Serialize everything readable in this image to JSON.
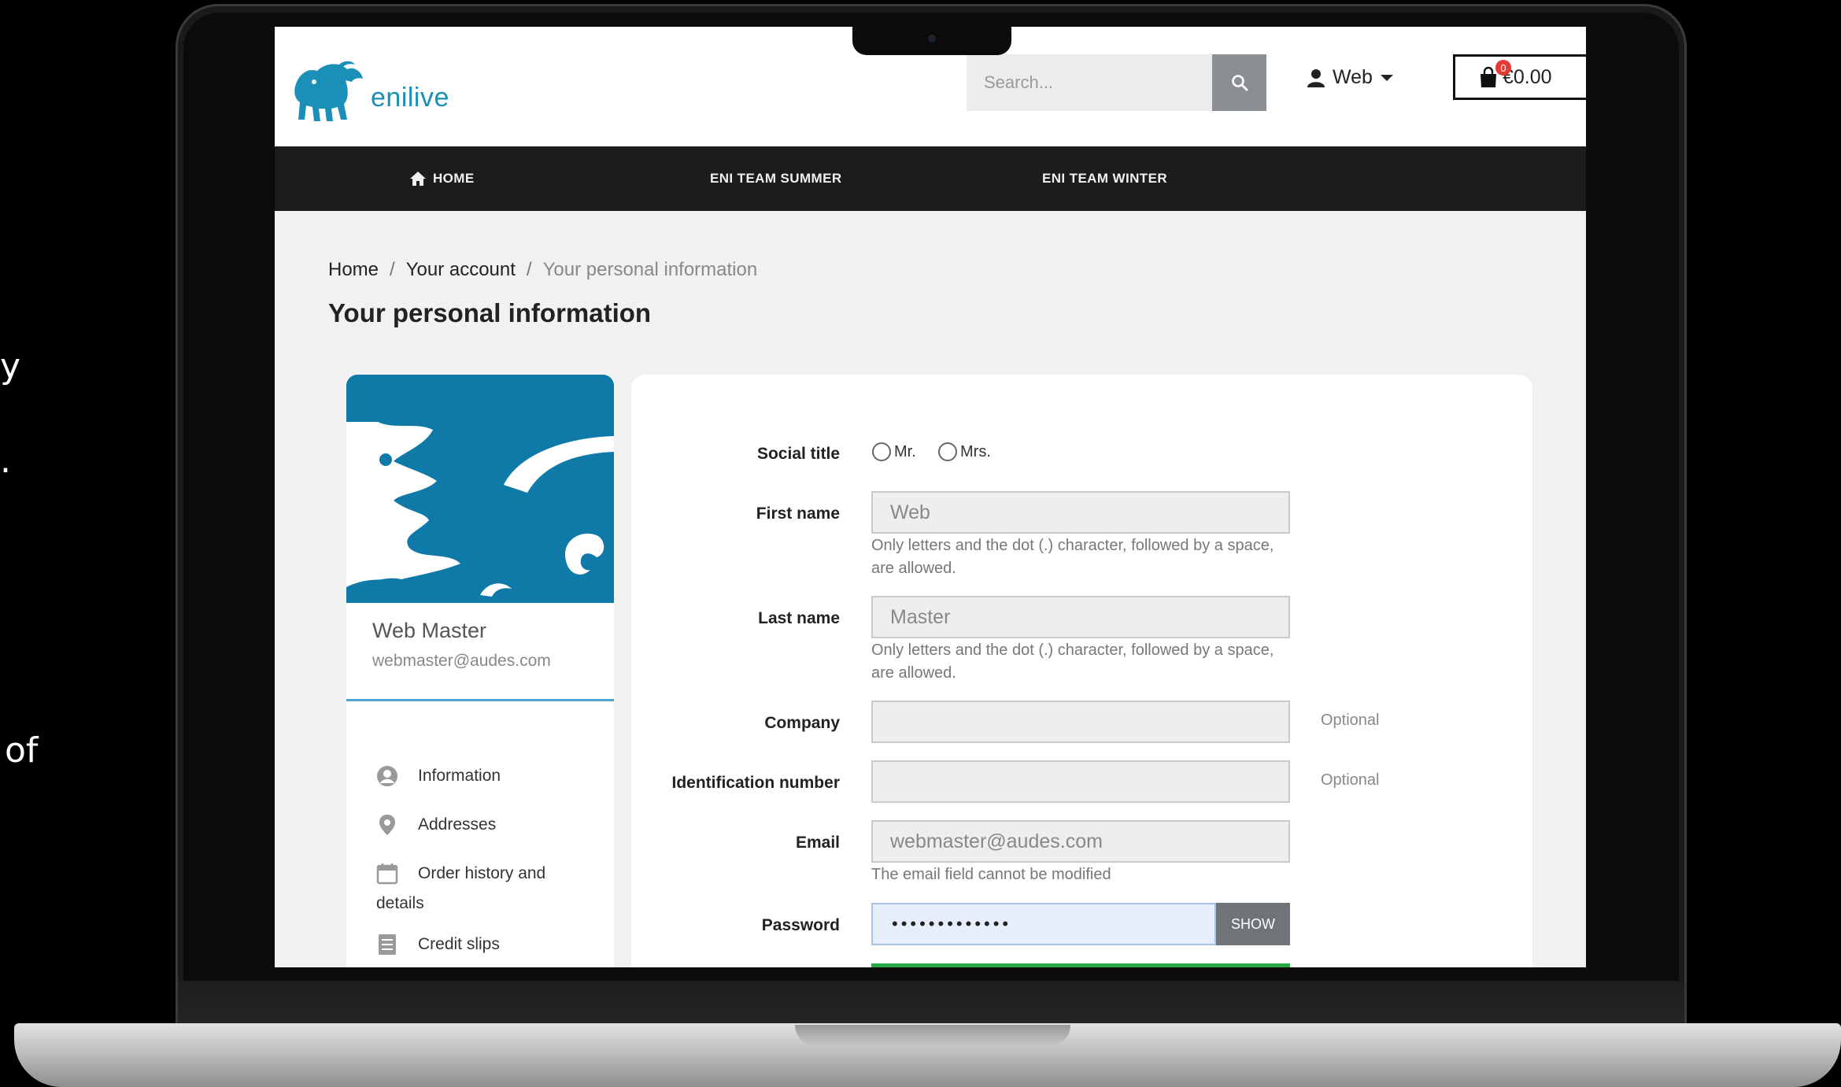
{
  "left_fragments": [
    {
      "text": "y"
    },
    {
      "text": "."
    },
    {
      "text": "of"
    }
  ],
  "header": {
    "logo_text": "enilive",
    "search_placeholder": "Search...",
    "user_label": "Web",
    "cart_count": "0",
    "cart_total": "€0.00"
  },
  "nav": {
    "items": [
      {
        "label": "HOME"
      },
      {
        "label": "ENI TEAM SUMMER"
      },
      {
        "label": "ENI TEAM WINTER"
      }
    ]
  },
  "breadcrumb": {
    "home": "Home",
    "account": "Your account",
    "current": "Your personal information",
    "separator": "/"
  },
  "page": {
    "title": "Your personal information"
  },
  "sidebar": {
    "name": "Web Master",
    "email": "webmaster@audes.com",
    "items": [
      {
        "label": "Information",
        "icon": "user-circle-icon"
      },
      {
        "label": "Addresses",
        "icon": "map-pin-icon"
      },
      {
        "label": "Order history and",
        "label2": "details",
        "icon": "calendar-icon"
      },
      {
        "label": "Credit slips",
        "icon": "document-icon"
      }
    ]
  },
  "form": {
    "social_title": {
      "label": "Social title",
      "options": [
        "Mr.",
        "Mrs."
      ]
    },
    "first_name": {
      "label": "First name",
      "value": "Web",
      "hint": "Only letters and the dot (.) character, followed by a space, are allowed."
    },
    "last_name": {
      "label": "Last name",
      "value": "Master",
      "hint": "Only letters and the dot (.) character, followed by a space, are allowed."
    },
    "company": {
      "label": "Company",
      "value": "",
      "optional": "Optional"
    },
    "identification": {
      "label": "Identification number",
      "value": "",
      "optional": "Optional"
    },
    "email": {
      "label": "Email",
      "value": "webmaster@audes.com",
      "hint": "The email field cannot be modified"
    },
    "password": {
      "label": "Password",
      "value": "•••••••••••••",
      "show_label": "SHOW"
    }
  },
  "colors": {
    "brand_blue": "#0f7aa8",
    "nav_bg": "#1c1c1c",
    "progress_green": "#27a844"
  }
}
